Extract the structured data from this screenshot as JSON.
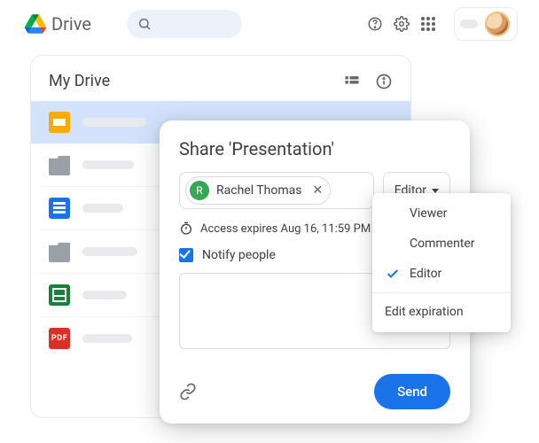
{
  "header": {
    "product_name": "Drive"
  },
  "drive": {
    "title": "My Drive",
    "files": [
      {
        "type": "slides"
      },
      {
        "type": "folder"
      },
      {
        "type": "docs"
      },
      {
        "type": "folder"
      },
      {
        "type": "sheets"
      },
      {
        "type": "pdf",
        "badge": "PDF"
      }
    ]
  },
  "share": {
    "title": "Share 'Presentation'",
    "person": {
      "initial": "R",
      "name": "Rachel Thomas"
    },
    "role_button": "Editor",
    "expiration_text": "Access expires Aug 16, 11:59 PM",
    "notify_label": "Notify people",
    "send_label": "Send"
  },
  "dropdown": {
    "items": [
      {
        "label": "Viewer",
        "selected": false
      },
      {
        "label": "Commenter",
        "selected": false
      },
      {
        "label": "Editor",
        "selected": true
      }
    ],
    "extra": "Edit expiration"
  }
}
